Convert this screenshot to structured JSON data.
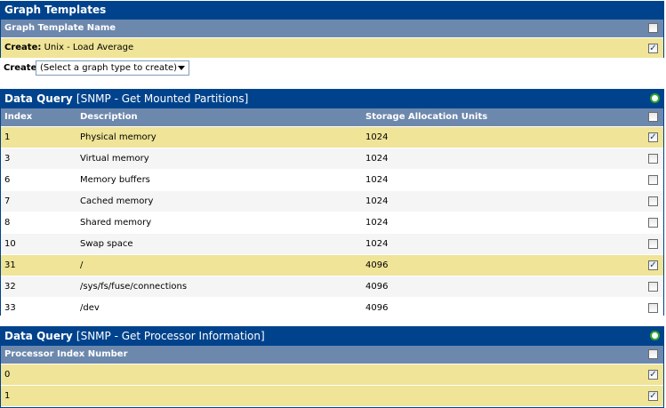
{
  "graph_templates": {
    "title": "Graph Templates",
    "column_header": "Graph Template Name",
    "row": {
      "prefix": "Create:",
      "name": "Unix - Load Average",
      "checked": true
    },
    "create_label": "Create:",
    "create_select": "(Select a graph type to create)"
  },
  "query1": {
    "title": "Data Query",
    "subtitle": "[SNMP - Get Mounted Partitions]",
    "headers": {
      "index": "Index",
      "description": "Description",
      "units": "Storage Allocation Units"
    },
    "rows": [
      {
        "index": "1",
        "description": "Physical memory",
        "units": "1024",
        "checked": true
      },
      {
        "index": "3",
        "description": "Virtual memory",
        "units": "1024",
        "checked": false
      },
      {
        "index": "6",
        "description": "Memory buffers",
        "units": "1024",
        "checked": false
      },
      {
        "index": "7",
        "description": "Cached memory",
        "units": "1024",
        "checked": false
      },
      {
        "index": "8",
        "description": "Shared memory",
        "units": "1024",
        "checked": false
      },
      {
        "index": "10",
        "description": "Swap space",
        "units": "1024",
        "checked": false
      },
      {
        "index": "31",
        "description": "/",
        "units": "4096",
        "checked": true
      },
      {
        "index": "32",
        "description": "/sys/fs/fuse/connections",
        "units": "4096",
        "checked": false
      },
      {
        "index": "33",
        "description": "/dev",
        "units": "4096",
        "checked": false
      }
    ]
  },
  "query2": {
    "title": "Data Query",
    "subtitle": "[SNMP - Get Processor Information]",
    "headers": {
      "index": "Processor Index Number"
    },
    "rows": [
      {
        "index": "0",
        "checked": true
      },
      {
        "index": "1",
        "checked": true
      }
    ]
  },
  "colors": {
    "title_bar": "#00438c",
    "header": "#6d88ad",
    "selected_row": "#efe497",
    "alt_row": "#f5f5f5"
  }
}
